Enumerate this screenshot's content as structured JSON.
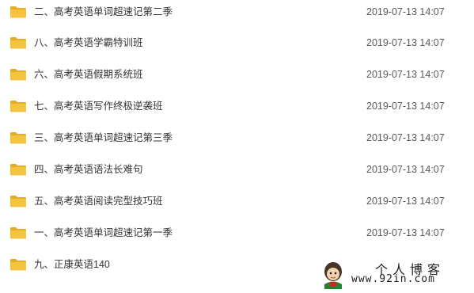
{
  "files": [
    {
      "name": "二、高考英语单词超速记第二季",
      "date": "2019-07-13 14:07"
    },
    {
      "name": "八、高考英语学霸特训班",
      "date": "2019-07-13 14:07"
    },
    {
      "name": "六、高考英语假期系统班",
      "date": "2019-07-13 14:07"
    },
    {
      "name": "七、高考英语写作终极逆袭班",
      "date": "2019-07-13 14:07"
    },
    {
      "name": "三、高考英语单词超速记第三季",
      "date": "2019-07-13 14:07"
    },
    {
      "name": "四、高考英语语法长难句",
      "date": "2019-07-13 14:07"
    },
    {
      "name": "五、高考英语阅读完型技巧班",
      "date": "2019-07-13 14:07"
    },
    {
      "name": "一、高考英语单词超速记第一季",
      "date": "2019-07-13 14:07"
    },
    {
      "name": "九、正康英语140",
      "date": ""
    }
  ],
  "icons": {
    "folder": "folder-icon",
    "mascot": "mascot-logo"
  },
  "colors": {
    "folder_fill": "#F6C242",
    "folder_tab": "#E8AE22"
  },
  "watermark": {
    "title": "个人博客",
    "url": "www.92in.com"
  }
}
